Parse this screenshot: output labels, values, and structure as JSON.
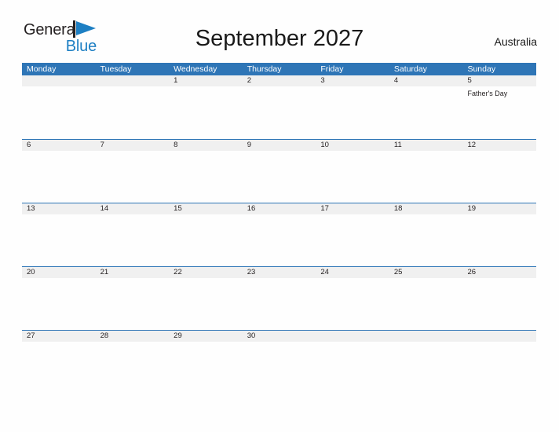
{
  "brand": {
    "name_part1": "General",
    "name_part2": "Blue",
    "flag_color": "#1d7fc3",
    "text_color": "#231f20"
  },
  "header": {
    "title": "September 2027",
    "region": "Australia"
  },
  "theme": {
    "header_blue": "#2e75b6",
    "band_gray": "#f0f0f0",
    "page_background": "#fefefe",
    "text_color": "#231f20"
  },
  "calendar": {
    "month": "September",
    "year": "2027",
    "weekday_headers": [
      "Monday",
      "Tuesday",
      "Wednesday",
      "Thursday",
      "Friday",
      "Saturday",
      "Sunday"
    ],
    "weeks": [
      [
        {
          "day": ""
        },
        {
          "day": ""
        },
        {
          "day": "1"
        },
        {
          "day": "2"
        },
        {
          "day": "3"
        },
        {
          "day": "4"
        },
        {
          "day": "5",
          "events": [
            "Father's Day"
          ]
        }
      ],
      [
        {
          "day": "6"
        },
        {
          "day": "7"
        },
        {
          "day": "8"
        },
        {
          "day": "9"
        },
        {
          "day": "10"
        },
        {
          "day": "11"
        },
        {
          "day": "12"
        }
      ],
      [
        {
          "day": "13"
        },
        {
          "day": "14"
        },
        {
          "day": "15"
        },
        {
          "day": "16"
        },
        {
          "day": "17"
        },
        {
          "day": "18"
        },
        {
          "day": "19"
        }
      ],
      [
        {
          "day": "20"
        },
        {
          "day": "21"
        },
        {
          "day": "22"
        },
        {
          "day": "23"
        },
        {
          "day": "24"
        },
        {
          "day": "25"
        },
        {
          "day": "26"
        }
      ],
      [
        {
          "day": "27"
        },
        {
          "day": "28"
        },
        {
          "day": "29"
        },
        {
          "day": "30"
        },
        {
          "day": ""
        },
        {
          "day": ""
        },
        {
          "day": ""
        }
      ]
    ]
  }
}
